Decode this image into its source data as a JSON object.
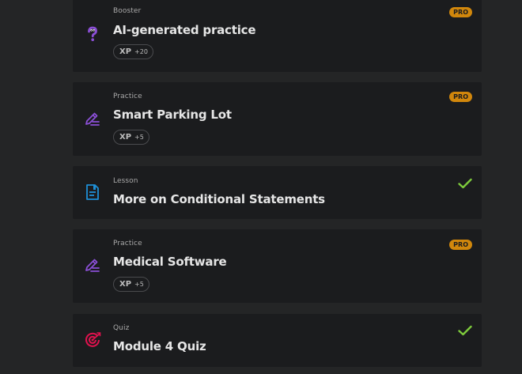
{
  "items": [
    {
      "type": "Booster",
      "title": "AI-generated practice",
      "xp_label": "XP",
      "xp_value": "+20",
      "badge": "PRO",
      "icon": "question-icon"
    },
    {
      "type": "Practice",
      "title": "Smart Parking Lot",
      "xp_label": "XP",
      "xp_value": "+5",
      "badge": "PRO",
      "icon": "pencil-edit-icon"
    },
    {
      "type": "Lesson",
      "title": "More on Conditional Statements",
      "status": "completed",
      "icon": "document-icon"
    },
    {
      "type": "Practice",
      "title": "Medical Software",
      "xp_label": "XP",
      "xp_value": "+5",
      "badge": "PRO",
      "icon": "pencil-edit-icon"
    },
    {
      "type": "Quiz",
      "title": "Module 4 Quiz",
      "status": "completed",
      "icon": "target-icon"
    }
  ],
  "colors": {
    "background": "#242526",
    "card": "#1b1c1e",
    "pro_badge": "#d1870c",
    "check": "#7ecb3c",
    "practice_icon": "#8b4fd6",
    "lesson_icon": "#1e8fd6",
    "quiz_icon": "#e0124e"
  }
}
